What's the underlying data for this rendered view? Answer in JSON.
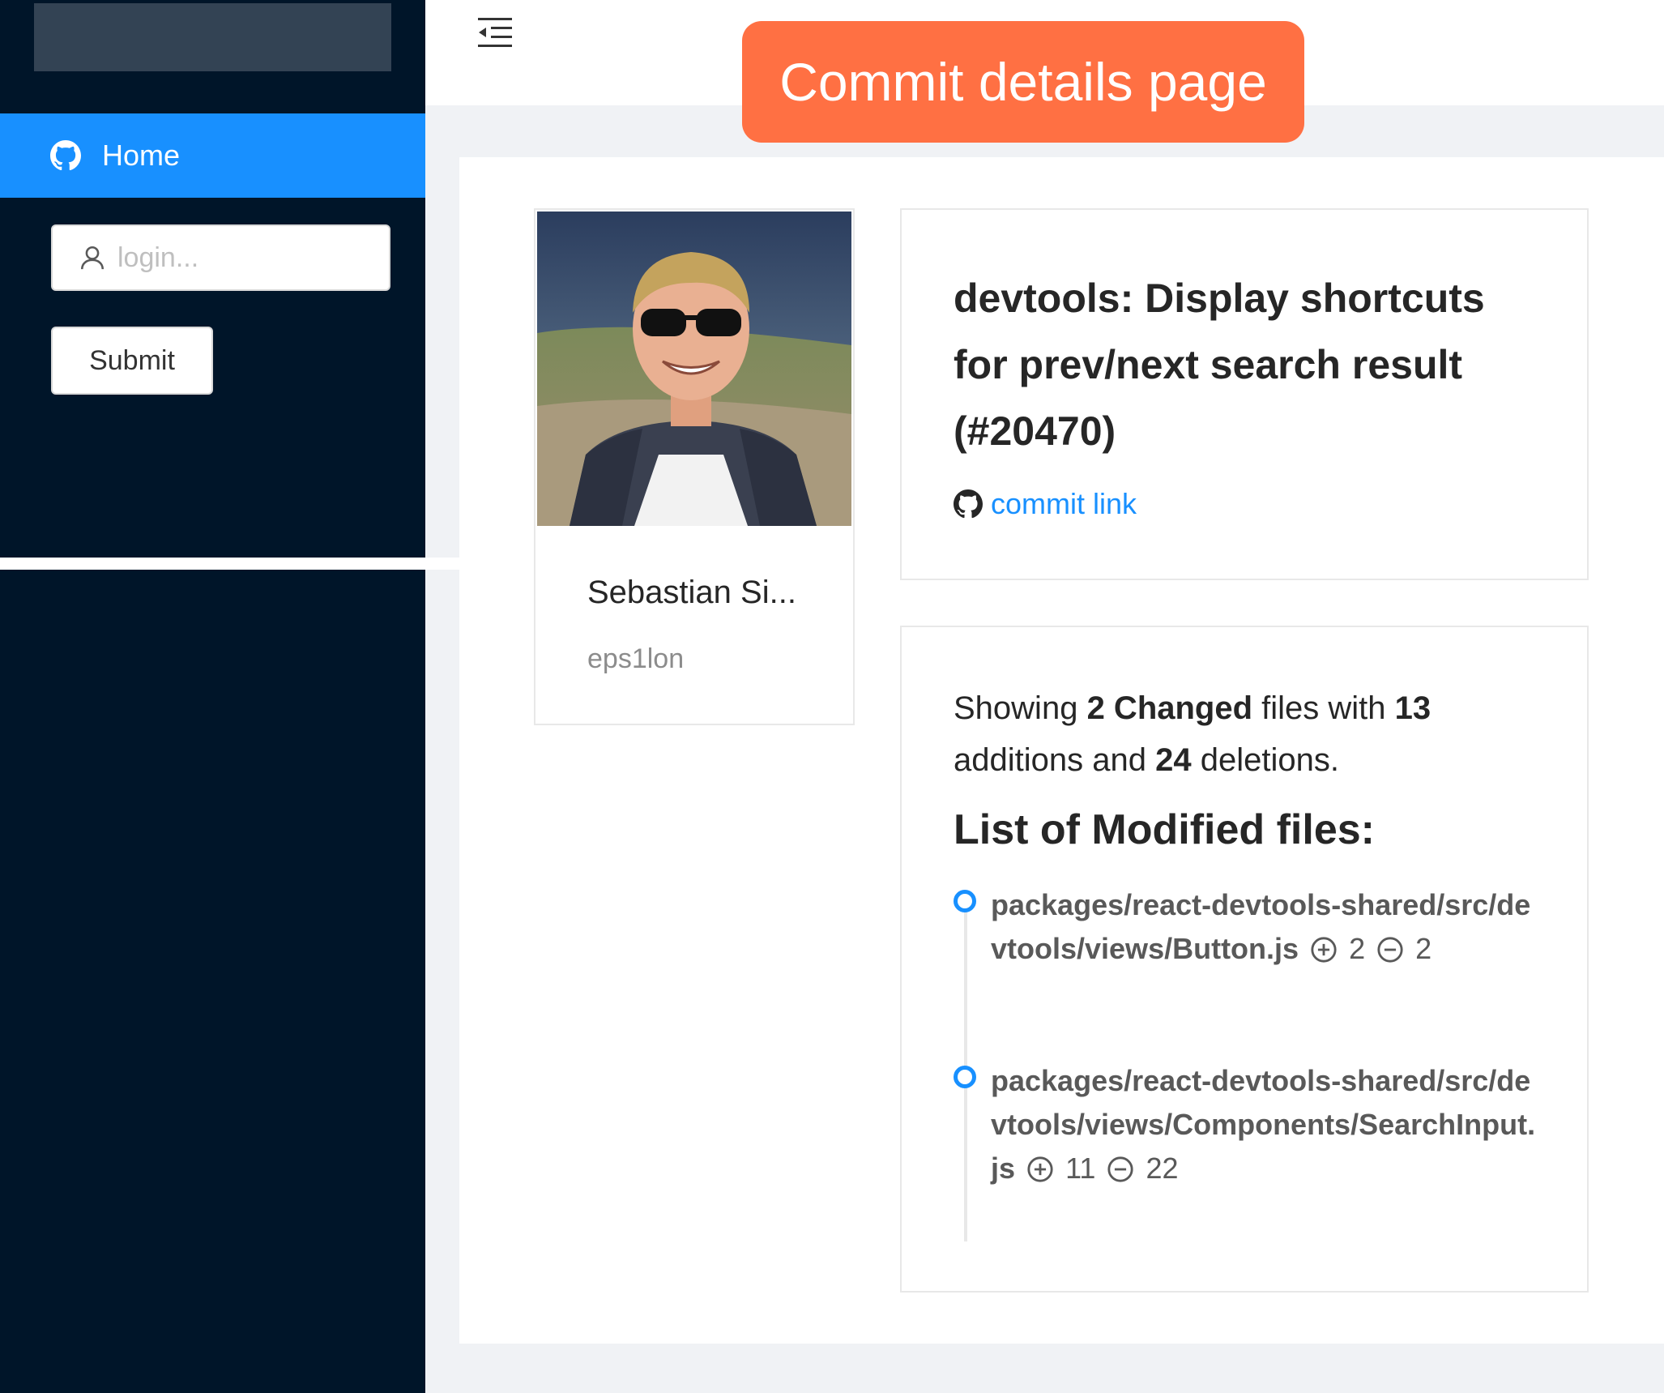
{
  "sidebar": {
    "menu": [
      {
        "label": "Home",
        "icon": "github-icon"
      }
    ],
    "login_placeholder": "login...",
    "submit_label": "Submit"
  },
  "header": {
    "fold_icon": "menu-fold-icon",
    "banner": "Commit details page"
  },
  "author": {
    "name": "Sebastian Si...",
    "login": "eps1lon"
  },
  "commit": {
    "title": "devtools: Display shortcuts for prev/next search result (#20470)",
    "link_label": "commit link"
  },
  "summary": {
    "prefix": "Showing ",
    "changed_files": "2",
    "changed_label": " Changed",
    "mid1": " files with ",
    "additions": "13",
    "mid2": " additions and ",
    "deletions": "24",
    "suffix": " deletions."
  },
  "files_title": "List of Modified files:",
  "files": [
    {
      "path": "packages/react-devtools-shared/src/devtools/views/Button.js",
      "additions": "2",
      "deletions": "2"
    },
    {
      "path": "packages/react-devtools-shared/src/devtools/views/Components/SearchInput.js",
      "additions": "11",
      "deletions": "22"
    }
  ],
  "colors": {
    "sidebar_bg": "#001529",
    "accent": "#1890ff",
    "banner": "#ff7043"
  }
}
